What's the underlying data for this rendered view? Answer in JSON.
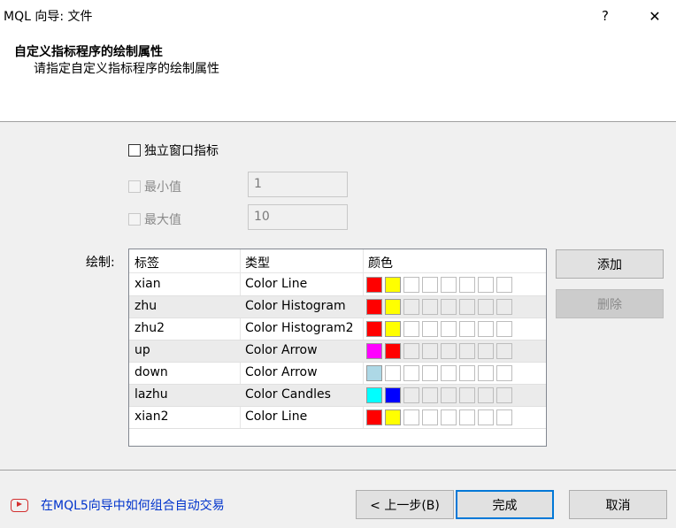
{
  "window": {
    "title": "MQL 向导: 文件",
    "help_label": "?",
    "close_label": "✕"
  },
  "header": {
    "title": "自定义指标程序的绘制属性",
    "subtitle": "请指定自定义指标程序的绘制属性"
  },
  "options": {
    "separate_window": {
      "label": "独立窗口指标",
      "checked": false
    },
    "minimum": {
      "label": "最小值",
      "value": "1",
      "enabled": false
    },
    "maximum": {
      "label": "最大值",
      "value": "10",
      "enabled": false
    }
  },
  "plots": {
    "label": "绘制:",
    "columns": [
      "标签",
      "类型",
      "颜色"
    ],
    "rows": [
      {
        "label": "xian",
        "type": "Color Line",
        "colors": [
          "#ff0000",
          "#ffff00"
        ]
      },
      {
        "label": "zhu",
        "type": "Color Histogram",
        "colors": [
          "#ff0000",
          "#ffff00"
        ]
      },
      {
        "label": "zhu2",
        "type": "Color Histogram2",
        "colors": [
          "#ff0000",
          "#ffff00"
        ]
      },
      {
        "label": "up",
        "type": "Color Arrow",
        "colors": [
          "#ff00ff",
          "#ff0000"
        ]
      },
      {
        "label": "down",
        "type": "Color Arrow",
        "colors": [
          "#add8e6"
        ]
      },
      {
        "label": "lazhu",
        "type": "Color Candles",
        "colors": [
          "#00ffff",
          "#0000ff"
        ]
      },
      {
        "label": "xian2",
        "type": "Color Line",
        "colors": [
          "#ff0000",
          "#ffff00"
        ]
      }
    ],
    "add_label": "添加",
    "delete_label": "删除"
  },
  "footer": {
    "help_link": "在MQL5向导中如何组合自动交易",
    "back_label": "< 上一步(B)",
    "finish_label": "完成",
    "cancel_label": "取消"
  }
}
